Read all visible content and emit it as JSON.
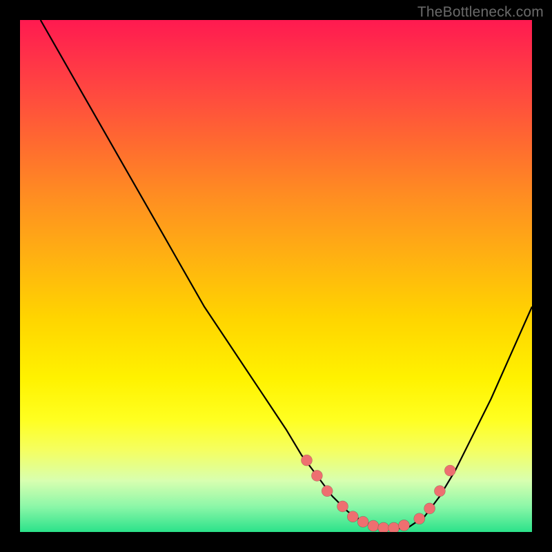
{
  "watermark": "TheBottleneck.com",
  "chart_data": {
    "type": "line",
    "title": "",
    "xlabel": "",
    "ylabel": "",
    "xlim": [
      0,
      100
    ],
    "ylim": [
      0,
      100
    ],
    "grid": false,
    "legend": false,
    "series": [
      {
        "name": "curve",
        "x": [
          4,
          8,
          12,
          16,
          20,
          24,
          28,
          32,
          36,
          40,
          44,
          48,
          52,
          55,
          58,
          61,
          64,
          67,
          70,
          73,
          76,
          79,
          82,
          85,
          88,
          92,
          96,
          100
        ],
        "y": [
          100,
          93,
          86,
          79,
          72,
          65,
          58,
          51,
          44,
          38,
          32,
          26,
          20,
          15,
          11,
          7,
          4,
          2,
          1,
          0.5,
          1,
          3,
          7,
          12,
          18,
          26,
          35,
          44
        ]
      }
    ],
    "points": {
      "name": "markers",
      "x": [
        56,
        58,
        60,
        63,
        65,
        67,
        69,
        71,
        73,
        75,
        78,
        80,
        82,
        84
      ],
      "y": [
        14,
        11,
        8,
        5,
        3,
        2,
        1.2,
        0.8,
        0.8,
        1.3,
        2.6,
        4.6,
        8,
        12
      ]
    }
  }
}
